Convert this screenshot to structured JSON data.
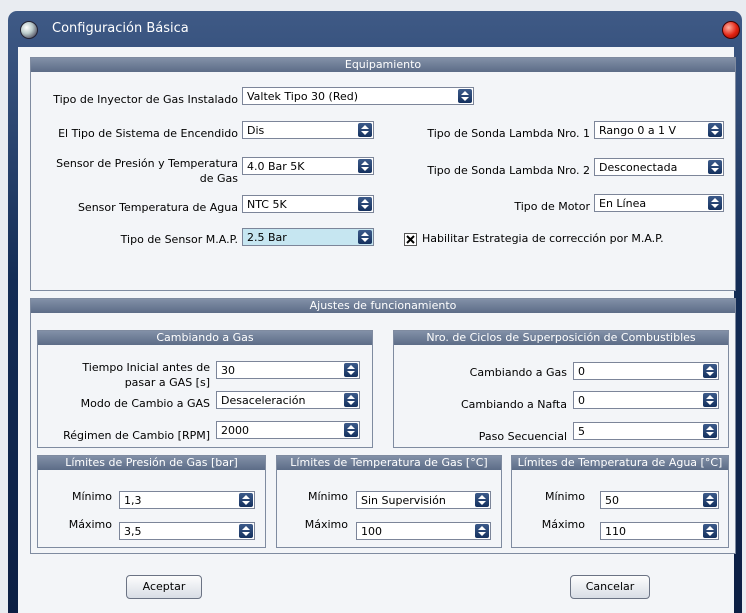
{
  "window": {
    "title": "Configuración Básica"
  },
  "equip": {
    "title": "Equipamiento",
    "inyector_label": "Tipo de Inyector de Gas Instalado",
    "inyector_value": "Valtek Tipo 30 (Red)",
    "encendido_label": "El Tipo de Sistema de Encendido",
    "encendido_value": "Dis",
    "sensor_presion_label_1": "Sensor de Presión y Temperatura",
    "sensor_presion_label_2": "de Gas",
    "sensor_presion_value": "4.0 Bar 5K",
    "sensor_agua_label": "Sensor Temperatura de Agua",
    "sensor_agua_value": "NTC 5K",
    "map_label": "Tipo de Sensor M.A.P.",
    "map_value": "2.5 Bar",
    "lambda1_label": "Tipo de Sonda Lambda Nro. 1",
    "lambda1_value": "Rango 0 a 1 V",
    "lambda2_label": "Tipo de Sonda Lambda Nro. 2",
    "lambda2_value": "Desconectada",
    "motor_label": "Tipo de Motor",
    "motor_value": "En Línea",
    "habilitar_label": "Habilitar Estrategia de corrección por M.A.P.",
    "habilitar_checked": true
  },
  "ajustes": {
    "title": "Ajustes de funcionamiento"
  },
  "cambio_gas": {
    "title": "Cambiando a Gas",
    "tiempo_label_1": "Tiempo Inicial antes de",
    "tiempo_label_2": "pasar a GAS [s]",
    "tiempo_value": "30",
    "modo_label": "Modo de Cambio a GAS",
    "modo_value": "Desaceleración",
    "regimen_label": "Régimen de Cambio [RPM]",
    "regimen_value": "2000"
  },
  "ciclos": {
    "title": "Nro. de Ciclos de Superposición de Combustibles",
    "gas_label": "Cambiando a Gas",
    "gas_value": "0",
    "nafta_label": "Cambiando a Nafta",
    "nafta_value": "0",
    "paso_label": "Paso Secuencial",
    "paso_value": "5"
  },
  "presion": {
    "title": "Límites de Presión de Gas [bar]",
    "min_label": "Mínimo",
    "min_value": "1,3",
    "max_label": "Máximo",
    "max_value": "3,5"
  },
  "temp_gas": {
    "title": "Límites de Temperatura de Gas [°C]",
    "min_label": "Mínimo",
    "min_value": "Sin Supervisión",
    "max_label": "Máximo",
    "max_value": "100"
  },
  "temp_agua": {
    "title": "Límites de Temperatura de Agua [°C]",
    "min_label": "Mínimo",
    "min_value": "50",
    "max_label": "Máximo",
    "max_value": "110"
  },
  "buttons": {
    "aceptar": "Aceptar",
    "cancelar": "Cancelar"
  }
}
